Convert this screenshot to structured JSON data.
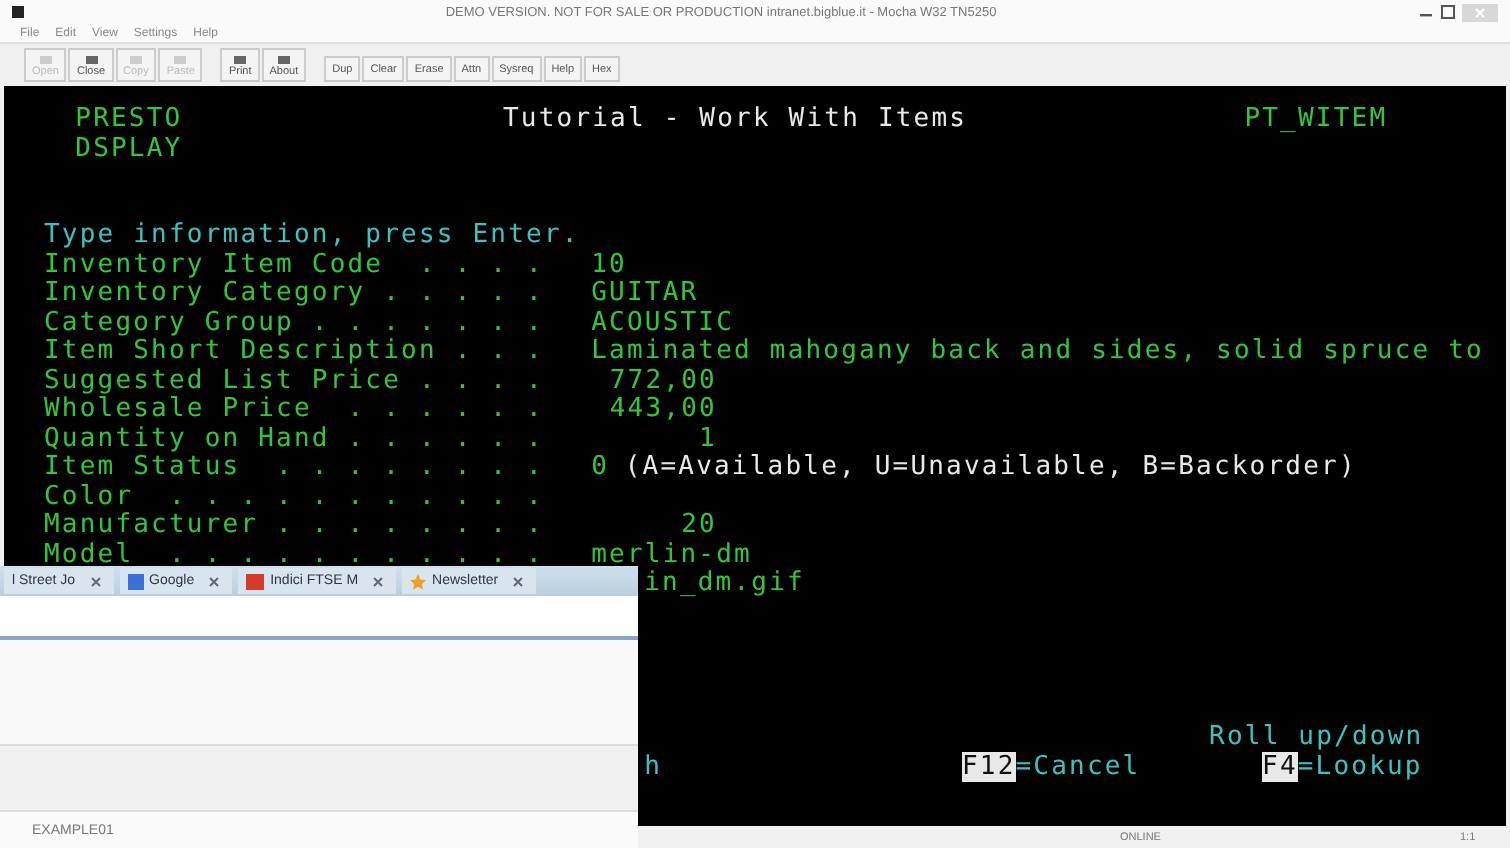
{
  "window": {
    "title": "DEMO VERSION. NOT FOR SALE OR PRODUCTION intranet.bigblue.it - Mocha W32 TN5250"
  },
  "menu": [
    "File",
    "Edit",
    "View",
    "Settings",
    "Help"
  ],
  "toolbar": [
    {
      "kind": "icon",
      "label": "Open",
      "disabled": true
    },
    {
      "kind": "icon",
      "label": "Close",
      "disabled": false
    },
    {
      "kind": "icon",
      "label": "Copy",
      "disabled": true
    },
    {
      "kind": "icon",
      "label": "Paste",
      "disabled": true
    },
    {
      "kind": "icon",
      "label": "Print",
      "disabled": false
    },
    {
      "kind": "icon",
      "label": "About",
      "disabled": false
    },
    {
      "kind": "text",
      "label": "Dup",
      "disabled": false
    },
    {
      "kind": "text",
      "label": "Clear",
      "disabled": false
    },
    {
      "kind": "text",
      "label": "Erase",
      "disabled": false
    },
    {
      "kind": "text",
      "label": "Attn",
      "disabled": false
    },
    {
      "kind": "text",
      "label": "Sysreq",
      "disabled": false
    },
    {
      "kind": "text",
      "label": "Help",
      "disabled": false
    },
    {
      "kind": "text",
      "label": "Hex",
      "disabled": false
    }
  ],
  "terminal": {
    "header_left": [
      "PRESTO",
      "DSPLAY"
    ],
    "title": "Tutorial - Work With Items",
    "program": "PT_WITEM",
    "instruction": "Type information, press Enter.",
    "fields": [
      {
        "label": "Inventory Item Code  . . . .",
        "value": "10",
        "kind": "text"
      },
      {
        "label": "Inventory Category . . . . .",
        "value": "GUITAR",
        "kind": "text"
      },
      {
        "label": "Category Group . . . . . . .",
        "value": "ACOUSTIC",
        "kind": "text"
      },
      {
        "label": "Item Short Description . . .",
        "value": "Laminated mahogany back and sides, solid spruce to",
        "kind": "text"
      },
      {
        "label": "Suggested List Price . . . .",
        "value": "772,00",
        "kind": "number"
      },
      {
        "label": "Wholesale Price  . . . . . .",
        "value": "443,00",
        "kind": "number"
      },
      {
        "label": "Quantity on Hand . . . . . .",
        "value": "1",
        "kind": "number"
      },
      {
        "label": "Item Status  . . . . . . . .",
        "value": "0",
        "hint": "(A=Available, U=Unavailable, B=Backorder)",
        "kind": "text"
      },
      {
        "label": "Color  . . . . . . . . . . .",
        "kind": "text"
      },
      {
        "label": "Manufacturer . . . . . . . .",
        "value": "20",
        "kind": "number"
      },
      {
        "label": "Model  . . . . . . . . . . .",
        "value": "merlin-dm",
        "kind": "text"
      },
      {
        "value": "in_dm.gif",
        "kind": "cut"
      }
    ],
    "roll_hint": "Roll up/down",
    "function_keys": [
      {
        "kind": "cut",
        "text": "h"
      },
      {
        "kind": "key",
        "key": "F12",
        "text": "=Cancel"
      },
      {
        "kind": "key",
        "key": "F4",
        "text": "=Lookup"
      }
    ]
  },
  "browser_overlay": {
    "tabs": [
      {
        "label": "l Street Jo",
        "kind": "plain"
      },
      {
        "label": "Google",
        "kind": "blue"
      },
      {
        "label": "Indici FTSE M",
        "kind": "red"
      },
      {
        "label": "Newsletter",
        "kind": "star"
      }
    ],
    "status": "EXAMPLE01"
  },
  "status_bar": {
    "connection": "ONLINE",
    "position": "1:1"
  }
}
